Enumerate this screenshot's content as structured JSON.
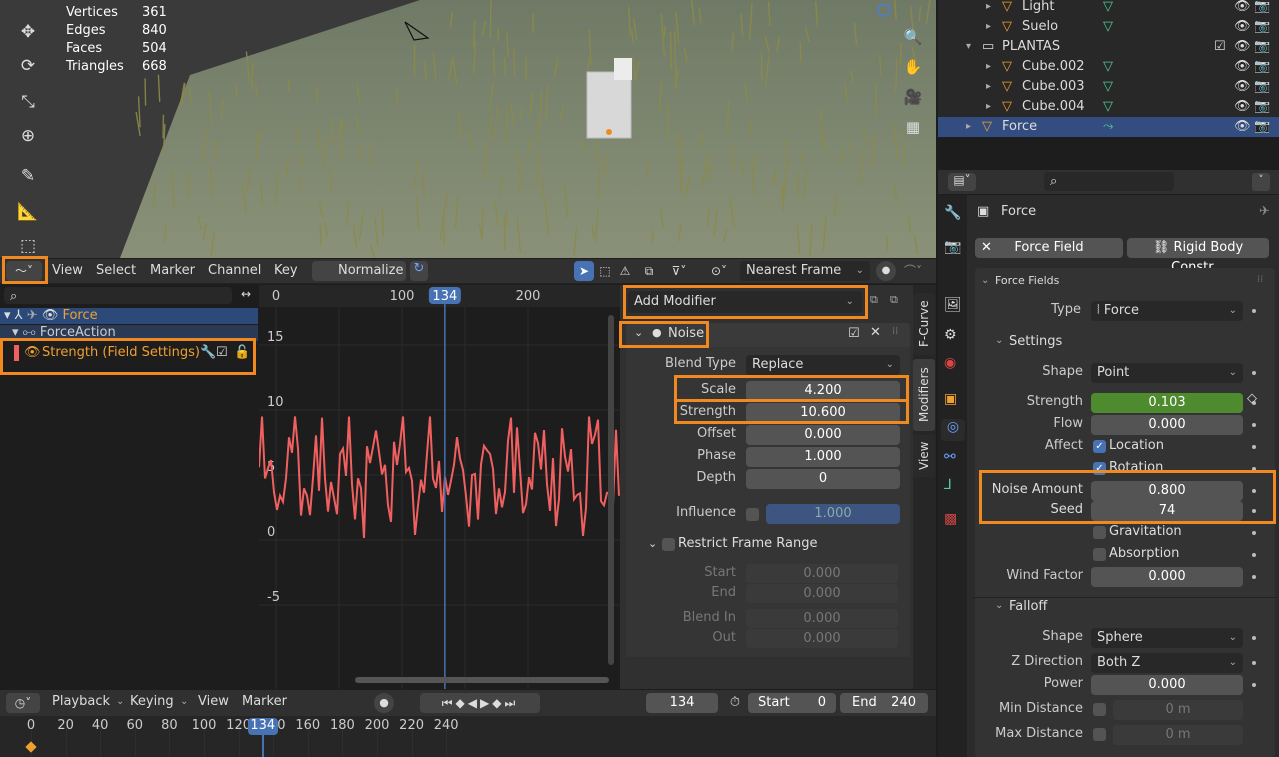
{
  "stats": {
    "rows": [
      {
        "k": "Vertices",
        "v": "361"
      },
      {
        "k": "Edges",
        "v": "840"
      },
      {
        "k": "Faces",
        "v": "504"
      },
      {
        "k": "Triangles",
        "v": "668"
      }
    ]
  },
  "outliner": {
    "rows": [
      {
        "label": "Light",
        "indent": 2,
        "arrow": "▸"
      },
      {
        "label": "Suelo",
        "indent": 2,
        "arrow": "▸"
      },
      {
        "label": "PLANTAS",
        "indent": 1,
        "arrow": "▾"
      },
      {
        "label": "Cube.002",
        "indent": 2,
        "arrow": "▸"
      },
      {
        "label": "Cube.003",
        "indent": 2,
        "arrow": "▸"
      },
      {
        "label": "Cube.004",
        "indent": 2,
        "arrow": "▸"
      },
      {
        "label": "Force",
        "indent": 1,
        "arrow": "▸",
        "selected": true
      }
    ]
  },
  "graph_header": {
    "menus": [
      "View",
      "Select",
      "Marker",
      "Channel",
      "Key"
    ],
    "normalize": "Normalize",
    "snap": "Nearest Frame"
  },
  "channels": {
    "root": "Force",
    "action": "ForceAction",
    "fcurve": "Strength (Field Settings)"
  },
  "graph": {
    "frame_ticks": [
      {
        "v": 0,
        "label": "0"
      },
      {
        "v": 100,
        "label": "100"
      },
      {
        "v": 200,
        "label": "200"
      }
    ],
    "current_frame": "134",
    "y_ticks": [
      {
        "v": 15,
        "label": "15"
      },
      {
        "v": 10,
        "label": "10"
      },
      {
        "v": 5,
        "label": "5"
      },
      {
        "v": 0,
        "label": "0"
      },
      {
        "v": -5,
        "label": "-5"
      }
    ],
    "curve_color": "#f06060"
  },
  "modifier_panel": {
    "add_modifier": "Add Modifier",
    "noise_title": "Noise",
    "blend_type_label": "Blend Type",
    "blend_type_value": "Replace",
    "rows": [
      {
        "label": "Scale",
        "value": "4.200"
      },
      {
        "label": "Strength",
        "value": "10.600"
      },
      {
        "label": "Offset",
        "value": "0.000"
      },
      {
        "label": "Phase",
        "value": "1.000"
      },
      {
        "label": "Depth",
        "value": "0"
      }
    ],
    "influence_label": "Influence",
    "influence_value": "1.000",
    "restrict_label": "Restrict Frame Range",
    "range_rows": [
      {
        "label": "Start",
        "value": "0.000"
      },
      {
        "label": "End",
        "value": "0.000"
      },
      {
        "label": "Blend In",
        "value": "0.000"
      },
      {
        "label": "Out",
        "value": "0.000"
      }
    ]
  },
  "side_tabs": [
    "F-Curve",
    "Modifiers",
    "View"
  ],
  "timeline": {
    "menus": [
      "Playback",
      "Keying",
      "View",
      "Marker"
    ],
    "current": "134",
    "start_label": "Start",
    "start": "0",
    "end_label": "End",
    "end": "240",
    "ticks": [
      "0",
      "20",
      "40",
      "60",
      "80",
      "100",
      "120",
      "140",
      "160",
      "180",
      "200",
      "220",
      "240"
    ]
  },
  "properties": {
    "object_name": "Force",
    "force_field_btn": "Force Field",
    "rigid_btn": "Rigid Body Constr...",
    "panel_title": "Force Fields",
    "type_label": "Type",
    "type_value": "Force",
    "settings_title": "Settings",
    "shape_label": "Shape",
    "shape_value": "Point",
    "strength_label": "Strength",
    "strength_value": "0.103",
    "flow_label": "Flow",
    "flow_value": "0.000",
    "affect_label": "Affect",
    "location": "Location",
    "rotation": "Rotation",
    "noise_amount_label": "Noise Amount",
    "noise_amount_value": "0.800",
    "seed_label": "Seed",
    "seed_value": "74",
    "gravitation": "Gravitation",
    "absorption": "Absorption",
    "wind_label": "Wind Factor",
    "wind_value": "0.000",
    "falloff_title": "Falloff",
    "f_shape_label": "Shape",
    "f_shape_value": "Sphere",
    "zdir_label": "Z Direction",
    "zdir_value": "Both Z",
    "power_label": "Power",
    "power_value": "0.000",
    "mindist_label": "Min Distance",
    "mindist_value": "0 m",
    "maxdist_label": "Max Distance",
    "maxdist_value": "0 m"
  },
  "colors": {
    "highlight": "#f08a20",
    "accent": "#4772b3",
    "strength_green": "#4e8a2e"
  }
}
